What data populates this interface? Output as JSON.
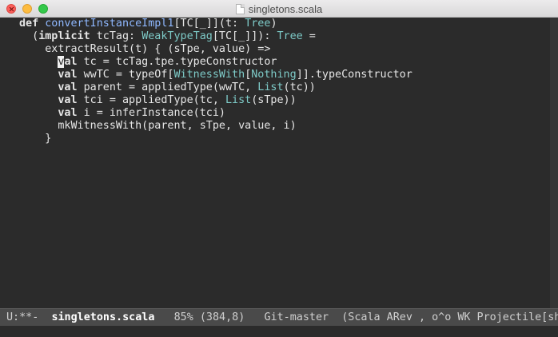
{
  "window": {
    "title": "singletons.scala"
  },
  "editor": {
    "lines": [
      [
        {
          "t": "def",
          "c": "kw"
        },
        {
          "t": " "
        },
        {
          "t": "convertInstanceImpl1",
          "c": "fn"
        },
        {
          "t": "[TC[_]](t: "
        },
        {
          "t": "Tree",
          "c": "ty"
        },
        {
          "t": ")"
        }
      ],
      [
        {
          "t": "  ("
        },
        {
          "t": "implicit",
          "c": "kw"
        },
        {
          "t": " tcTag: "
        },
        {
          "t": "WeakTypeTag",
          "c": "ty"
        },
        {
          "t": "[TC[_]]): "
        },
        {
          "t": "Tree",
          "c": "ty"
        },
        {
          "t": " ="
        }
      ],
      [
        {
          "t": "    extractResult(t) { (sTpe, value) =>"
        }
      ],
      [
        {
          "t": "      "
        },
        {
          "t": "v",
          "c": "cur"
        },
        {
          "t": "al",
          "c": "kw"
        },
        {
          "t": " tc = tcTag.tpe.typeConstructor"
        }
      ],
      [
        {
          "t": "      "
        },
        {
          "t": "val",
          "c": "kw"
        },
        {
          "t": " wwTC = typeOf["
        },
        {
          "t": "WitnessWith",
          "c": "ty"
        },
        {
          "t": "["
        },
        {
          "t": "Nothing",
          "c": "ty"
        },
        {
          "t": "]].typeConstructor"
        }
      ],
      [
        {
          "t": "      "
        },
        {
          "t": "val",
          "c": "kw"
        },
        {
          "t": " parent = appliedType(wwTC, "
        },
        {
          "t": "List",
          "c": "ty"
        },
        {
          "t": "(tc))"
        }
      ],
      [
        {
          "t": "      "
        },
        {
          "t": "val",
          "c": "kw"
        },
        {
          "t": " tci = appliedType(tc, "
        },
        {
          "t": "List",
          "c": "ty"
        },
        {
          "t": "(sTpe))"
        }
      ],
      [
        {
          "t": "      "
        },
        {
          "t": "val",
          "c": "kw"
        },
        {
          "t": " i = inferInstance(tci)"
        }
      ],
      [
        {
          "t": "      mkWitnessWith(parent, sTpe, value, i)"
        }
      ],
      [
        {
          "t": "    }"
        }
      ]
    ]
  },
  "modeline": {
    "status": "U:**-",
    "buffer": "singletons.scala",
    "position": "85% (384,8)",
    "vcs": "Git-master",
    "modes": "(Scala ARev , o^o WK Projectile[sh"
  }
}
